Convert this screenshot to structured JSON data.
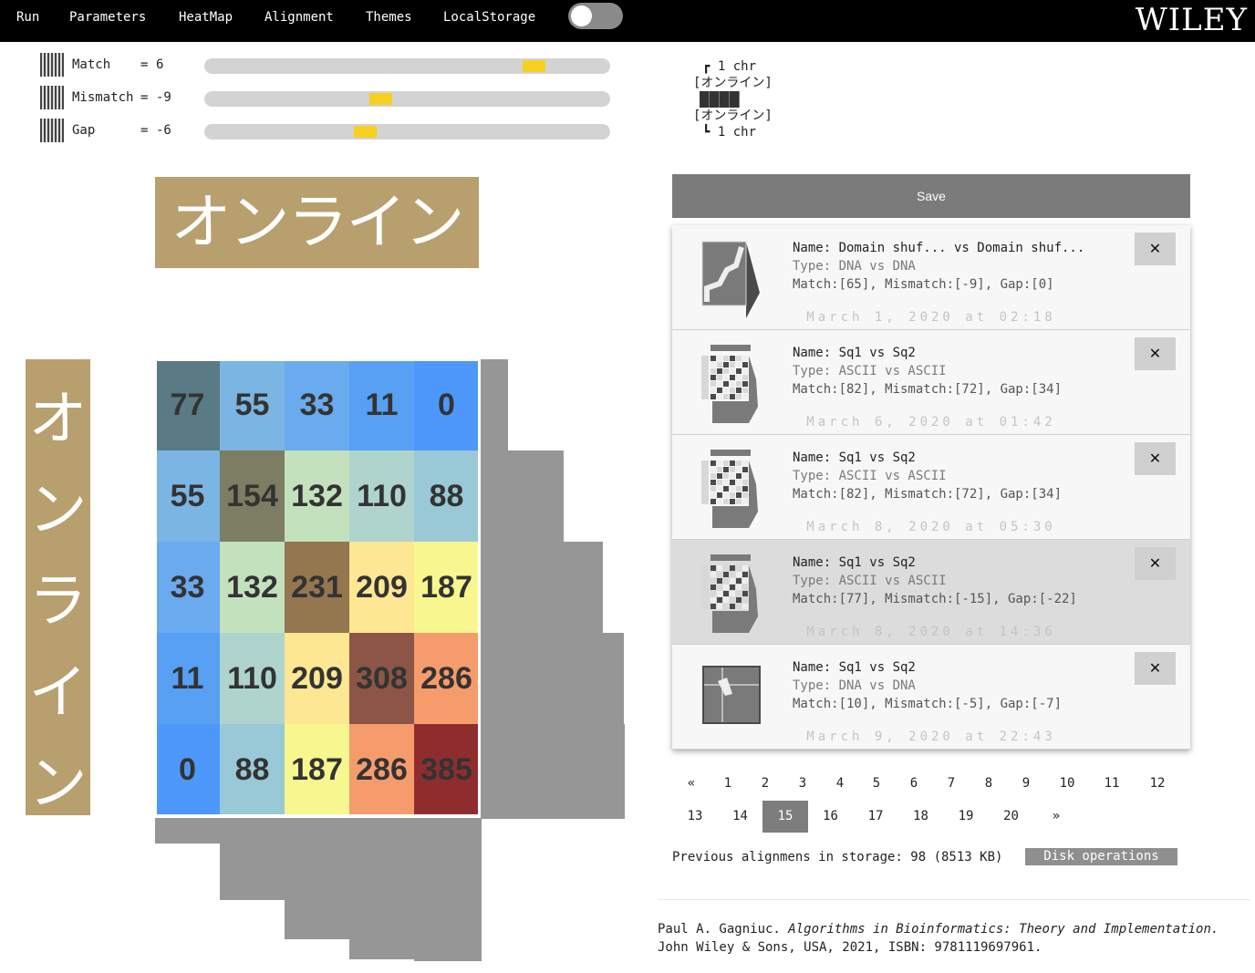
{
  "menu": {
    "items": [
      "Run",
      "Parameters",
      "HeatMap",
      "Alignment",
      "Themes",
      "LocalStorage"
    ],
    "brand": "WILEY"
  },
  "params": [
    {
      "label": "Match",
      "eq": "=",
      "value": "6",
      "level_percent": 83
    },
    {
      "label": "Mismatch",
      "eq": "=",
      "value": "-9",
      "level_percent": 43
    },
    {
      "label": "Gap",
      "eq": "=",
      "value": "-6",
      "level_percent": 39
    }
  ],
  "mini_alignment": {
    "top_bracket": "┏",
    "top_count": "1 chr",
    "seq1": "[オンライン]",
    "seq2": "[オンライン]",
    "bottom_bracket": "┗",
    "bottom_count": "1 chr"
  },
  "heatmap": {
    "seq_top": "オンライン",
    "seq_left": [
      "オ",
      "ン",
      "ラ",
      "イ",
      "ン"
    ],
    "header_color": "#b89f6e",
    "cells": [
      [
        {
          "v": "77",
          "c": "#5a7a85"
        },
        {
          "v": "55",
          "c": "#7bb5e3"
        },
        {
          "v": "33",
          "c": "#6aaaee"
        },
        {
          "v": "11",
          "c": "#57a0f3"
        },
        {
          "v": "0",
          "c": "#4d98fa"
        }
      ],
      [
        {
          "v": "55",
          "c": "#7bb5e3"
        },
        {
          "v": "154",
          "c": "#7c7d62"
        },
        {
          "v": "132",
          "c": "#c3e1bd"
        },
        {
          "v": "110",
          "c": "#aed4cd"
        },
        {
          "v": "88",
          "c": "#99c9d6"
        }
      ],
      [
        {
          "v": "33",
          "c": "#6aaaee"
        },
        {
          "v": "132",
          "c": "#c3e1bd"
        },
        {
          "v": "231",
          "c": "#94774f"
        },
        {
          "v": "209",
          "c": "#fde793"
        },
        {
          "v": "187",
          "c": "#f8f78f"
        }
      ],
      [
        {
          "v": "11",
          "c": "#57a0f3"
        },
        {
          "v": "110",
          "c": "#aed4cd"
        },
        {
          "v": "209",
          "c": "#fde793"
        },
        {
          "v": "308",
          "c": "#8c5546"
        },
        {
          "v": "286",
          "c": "#f69c6c"
        }
      ],
      [
        {
          "v": "0",
          "c": "#4d98fa"
        },
        {
          "v": "88",
          "c": "#99c9d6"
        },
        {
          "v": "187",
          "c": "#f8f78f"
        },
        {
          "v": "286",
          "c": "#f69c6c"
        },
        {
          "v": "385",
          "c": "#8f2d2e"
        }
      ]
    ]
  },
  "save_label": "Save",
  "saved": [
    {
      "name": "Name: Domain shuf... vs Domain shuf...",
      "type": "Type: DNA vs DNA",
      "params": "Match:[65], Mismatch:[-9], Gap:[0]",
      "date": "March 1, 2020 at 02:18",
      "close": "✕",
      "thumb": "zigzag"
    },
    {
      "name": "Name: Sq1 vs Sq2",
      "type": "Type: ASCII vs ASCII",
      "params": "Match:[82], Mismatch:[72], Gap:[34]",
      "date": "March 6, 2020 at 01:42",
      "close": "✕",
      "thumb": "table"
    },
    {
      "name": "Name: Sq1 vs Sq2",
      "type": "Type: ASCII vs ASCII",
      "params": "Match:[82], Mismatch:[72], Gap:[34]",
      "date": "March 8, 2020 at 05:30",
      "close": "✕",
      "thumb": "table"
    },
    {
      "name": "Name: Sq1 vs Sq2",
      "type": "Type: ASCII vs ASCII",
      "params": "Match:[77], Mismatch:[-15], Gap:[-22]",
      "date": "March 8, 2020 at 14:36",
      "close": "✕",
      "thumb": "table",
      "selected": true
    },
    {
      "name": "Name: Sq1 vs Sq2",
      "type": "Type: DNA vs DNA",
      "params": "Match:[10], Mismatch:[-5], Gap:[-7]",
      "date": "March 9, 2020 at 22:43",
      "close": "✕",
      "thumb": "cross"
    }
  ],
  "pagination": {
    "row1": [
      "«",
      "1",
      "2",
      "3",
      "4",
      "5",
      "6",
      "7",
      "8",
      "9",
      "10",
      "11",
      "12"
    ],
    "row2": [
      "13",
      "14",
      "15",
      "16",
      "17",
      "18",
      "19",
      "20",
      "»"
    ],
    "active": "15"
  },
  "storage_text": "Previous alignmens in storage: 98 (8513 KB)",
  "disk_button": "Disk operations",
  "citation": {
    "author": "Paul A. Gagniuc.",
    "title": "Algorithms in Bioinformatics: Theory and Implementation.",
    "rest": "John Wiley & Sons, USA, 2021, ISBN: 9781119697961."
  }
}
